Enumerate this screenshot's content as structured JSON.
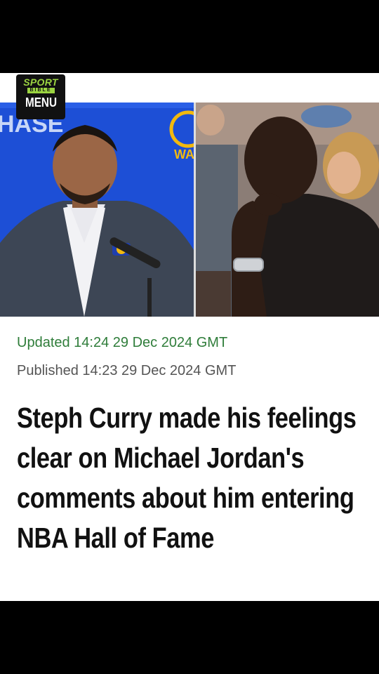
{
  "header": {
    "logo_top": "SPORT",
    "logo_middle": "BIBLE",
    "menu_label": "MENU"
  },
  "hero": {
    "left_backdrop_text": "HASE",
    "right_backdrop_text": "WA"
  },
  "article": {
    "updated": "Updated 14:24 29 Dec 2024 GMT",
    "published": "Published 14:23 29 Dec 2024 GMT",
    "headline": "Steph Curry made his feelings clear on Michael Jordan's comments about him entering NBA Hall of Fame"
  },
  "colors": {
    "brand_green": "#9bd441",
    "updated_green": "#2f7d3a",
    "warriors_blue": "#1d4fd6"
  }
}
